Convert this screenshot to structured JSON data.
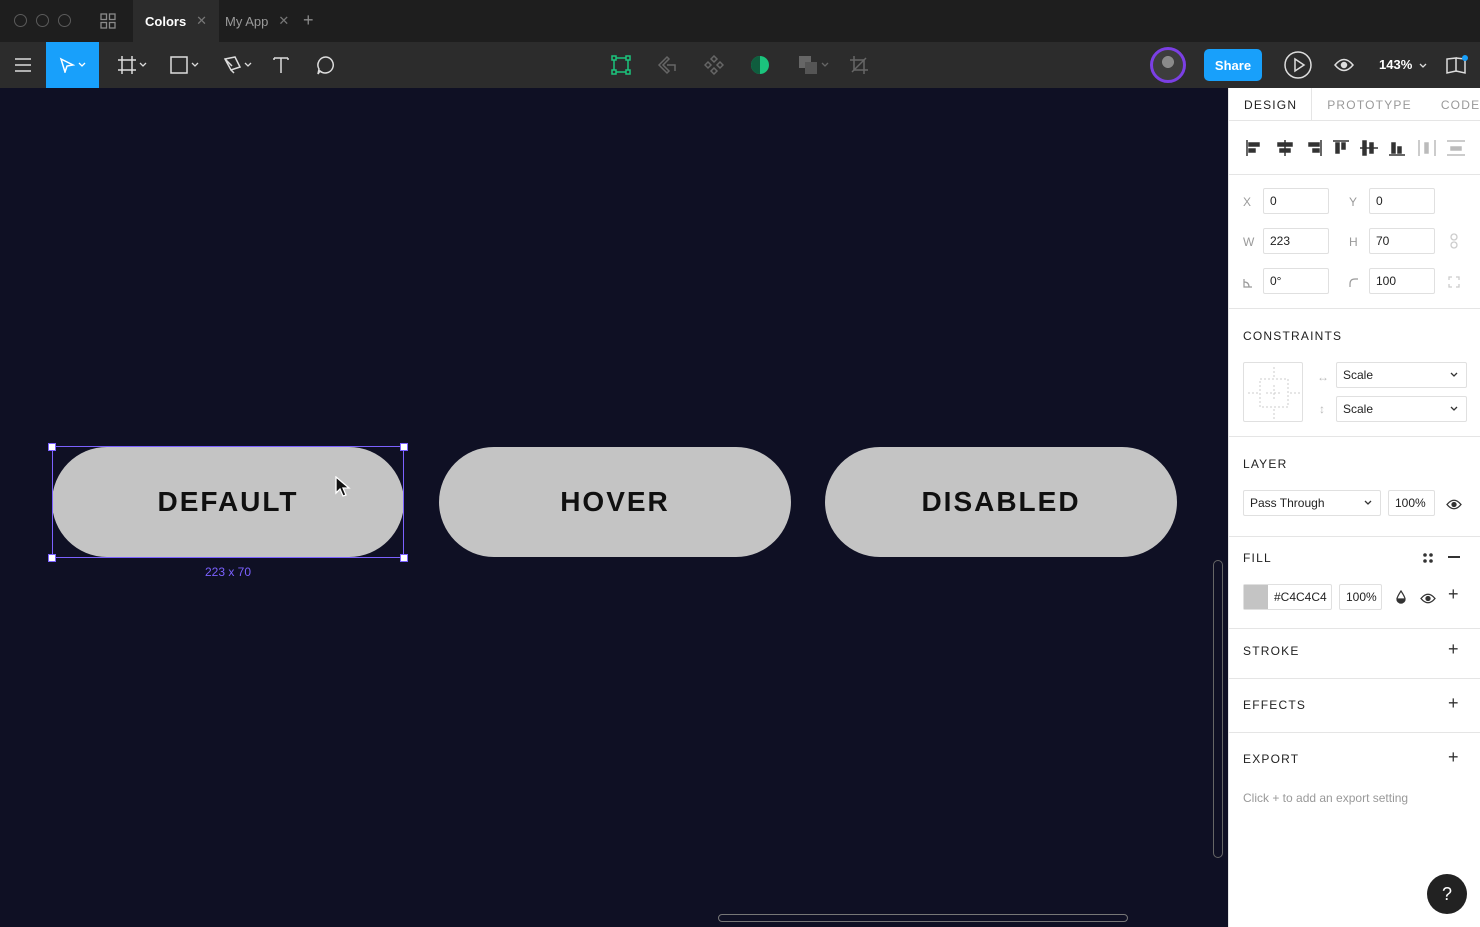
{
  "tabs": [
    {
      "label": "Colors"
    },
    {
      "label": "My App"
    }
  ],
  "toolbar": {
    "share_label": "Share",
    "zoom_level": "143%"
  },
  "canvas": {
    "buttons": [
      {
        "label": "DEFAULT"
      },
      {
        "label": "HOVER"
      },
      {
        "label": "DISABLED"
      }
    ],
    "selection_dims": "223 x 70"
  },
  "panel": {
    "tabs": [
      "DESIGN",
      "PROTOTYPE",
      "CODE"
    ],
    "x_label": "X",
    "x_value": "0",
    "y_label": "Y",
    "y_value": "0",
    "w_label": "W",
    "w_value": "223",
    "h_label": "H",
    "h_value": "70",
    "rotation_value": "0°",
    "radius_value": "100",
    "constraints_title": "CONSTRAINTS",
    "constraint_h": "Scale",
    "constraint_v": "Scale",
    "layer_title": "LAYER",
    "blend_mode": "Pass Through",
    "layer_opacity": "100%",
    "fill_title": "FILL",
    "fill_hex": "#C4C4C4",
    "fill_opacity": "100%",
    "stroke_title": "STROKE",
    "effects_title": "EFFECTS",
    "export_title": "EXPORT",
    "export_hint": "Click + to add an export setting",
    "help_label": "?"
  },
  "colors": {
    "accent": "#18a0fb",
    "selection": "#7b61ff",
    "canvas_bg": "#0f1024",
    "pill_fill": "#c4c4c4"
  }
}
